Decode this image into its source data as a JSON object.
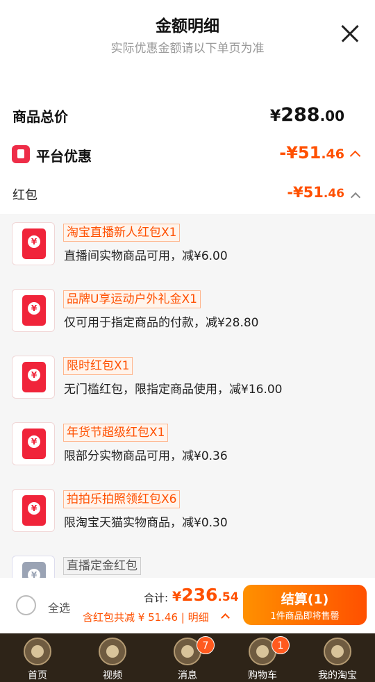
{
  "header": {
    "title": "金额明细",
    "subtitle": "实际优惠金额请以下单页为准"
  },
  "total": {
    "label": "商品总价",
    "currency": "¥",
    "integer": "288",
    "decimal": ".00"
  },
  "platform_discount": {
    "label": "平台优惠",
    "integer": "-¥51",
    "decimal": ".46"
  },
  "red_packet": {
    "label": "红包",
    "integer": "-¥51",
    "decimal": ".46"
  },
  "coupons": [
    {
      "name": "淘宝直播新人红包X1",
      "desc": "直播间实物商品可用，减¥6.00",
      "icon": "red-envelope-icon"
    },
    {
      "name": "品牌U享运动户外礼金X1",
      "desc": "仅可用于指定商品的付款，减¥28.80",
      "icon": "red-envelope-icon"
    },
    {
      "name": "限时红包X1",
      "desc": "无门槛红包，限指定商品使用，减¥16.00",
      "icon": "red-envelope-icon"
    },
    {
      "name": "年货节超级红包X1",
      "desc": "限部分实物商品可用，减¥0.36",
      "icon": "red-envelope-icon"
    },
    {
      "name": "拍拍乐拍照领红包X6",
      "desc": "限淘宝天猫实物商品，减¥0.30",
      "icon": "red-envelope-icon"
    },
    {
      "name": "直播定金红包",
      "desc": "",
      "icon": "deposit-envelope-icon"
    }
  ],
  "checkout": {
    "select_all": "全选",
    "sum_label": "合计:",
    "sum_currency": "¥",
    "sum_integer": "236",
    "sum_decimal": ".54",
    "detail": "含红包共减 ¥ 51.46 | 明细",
    "button_main": "结算(1)",
    "button_sub": "1件商品即将售罄",
    "accent": "#ff5000"
  },
  "tabbar": {
    "items": [
      {
        "label": "首页",
        "badge": ""
      },
      {
        "label": "视频",
        "badge": ""
      },
      {
        "label": "消息",
        "badge": "7"
      },
      {
        "label": "购物车",
        "badge": "1"
      },
      {
        "label": "我的淘宝",
        "badge": ""
      }
    ]
  }
}
